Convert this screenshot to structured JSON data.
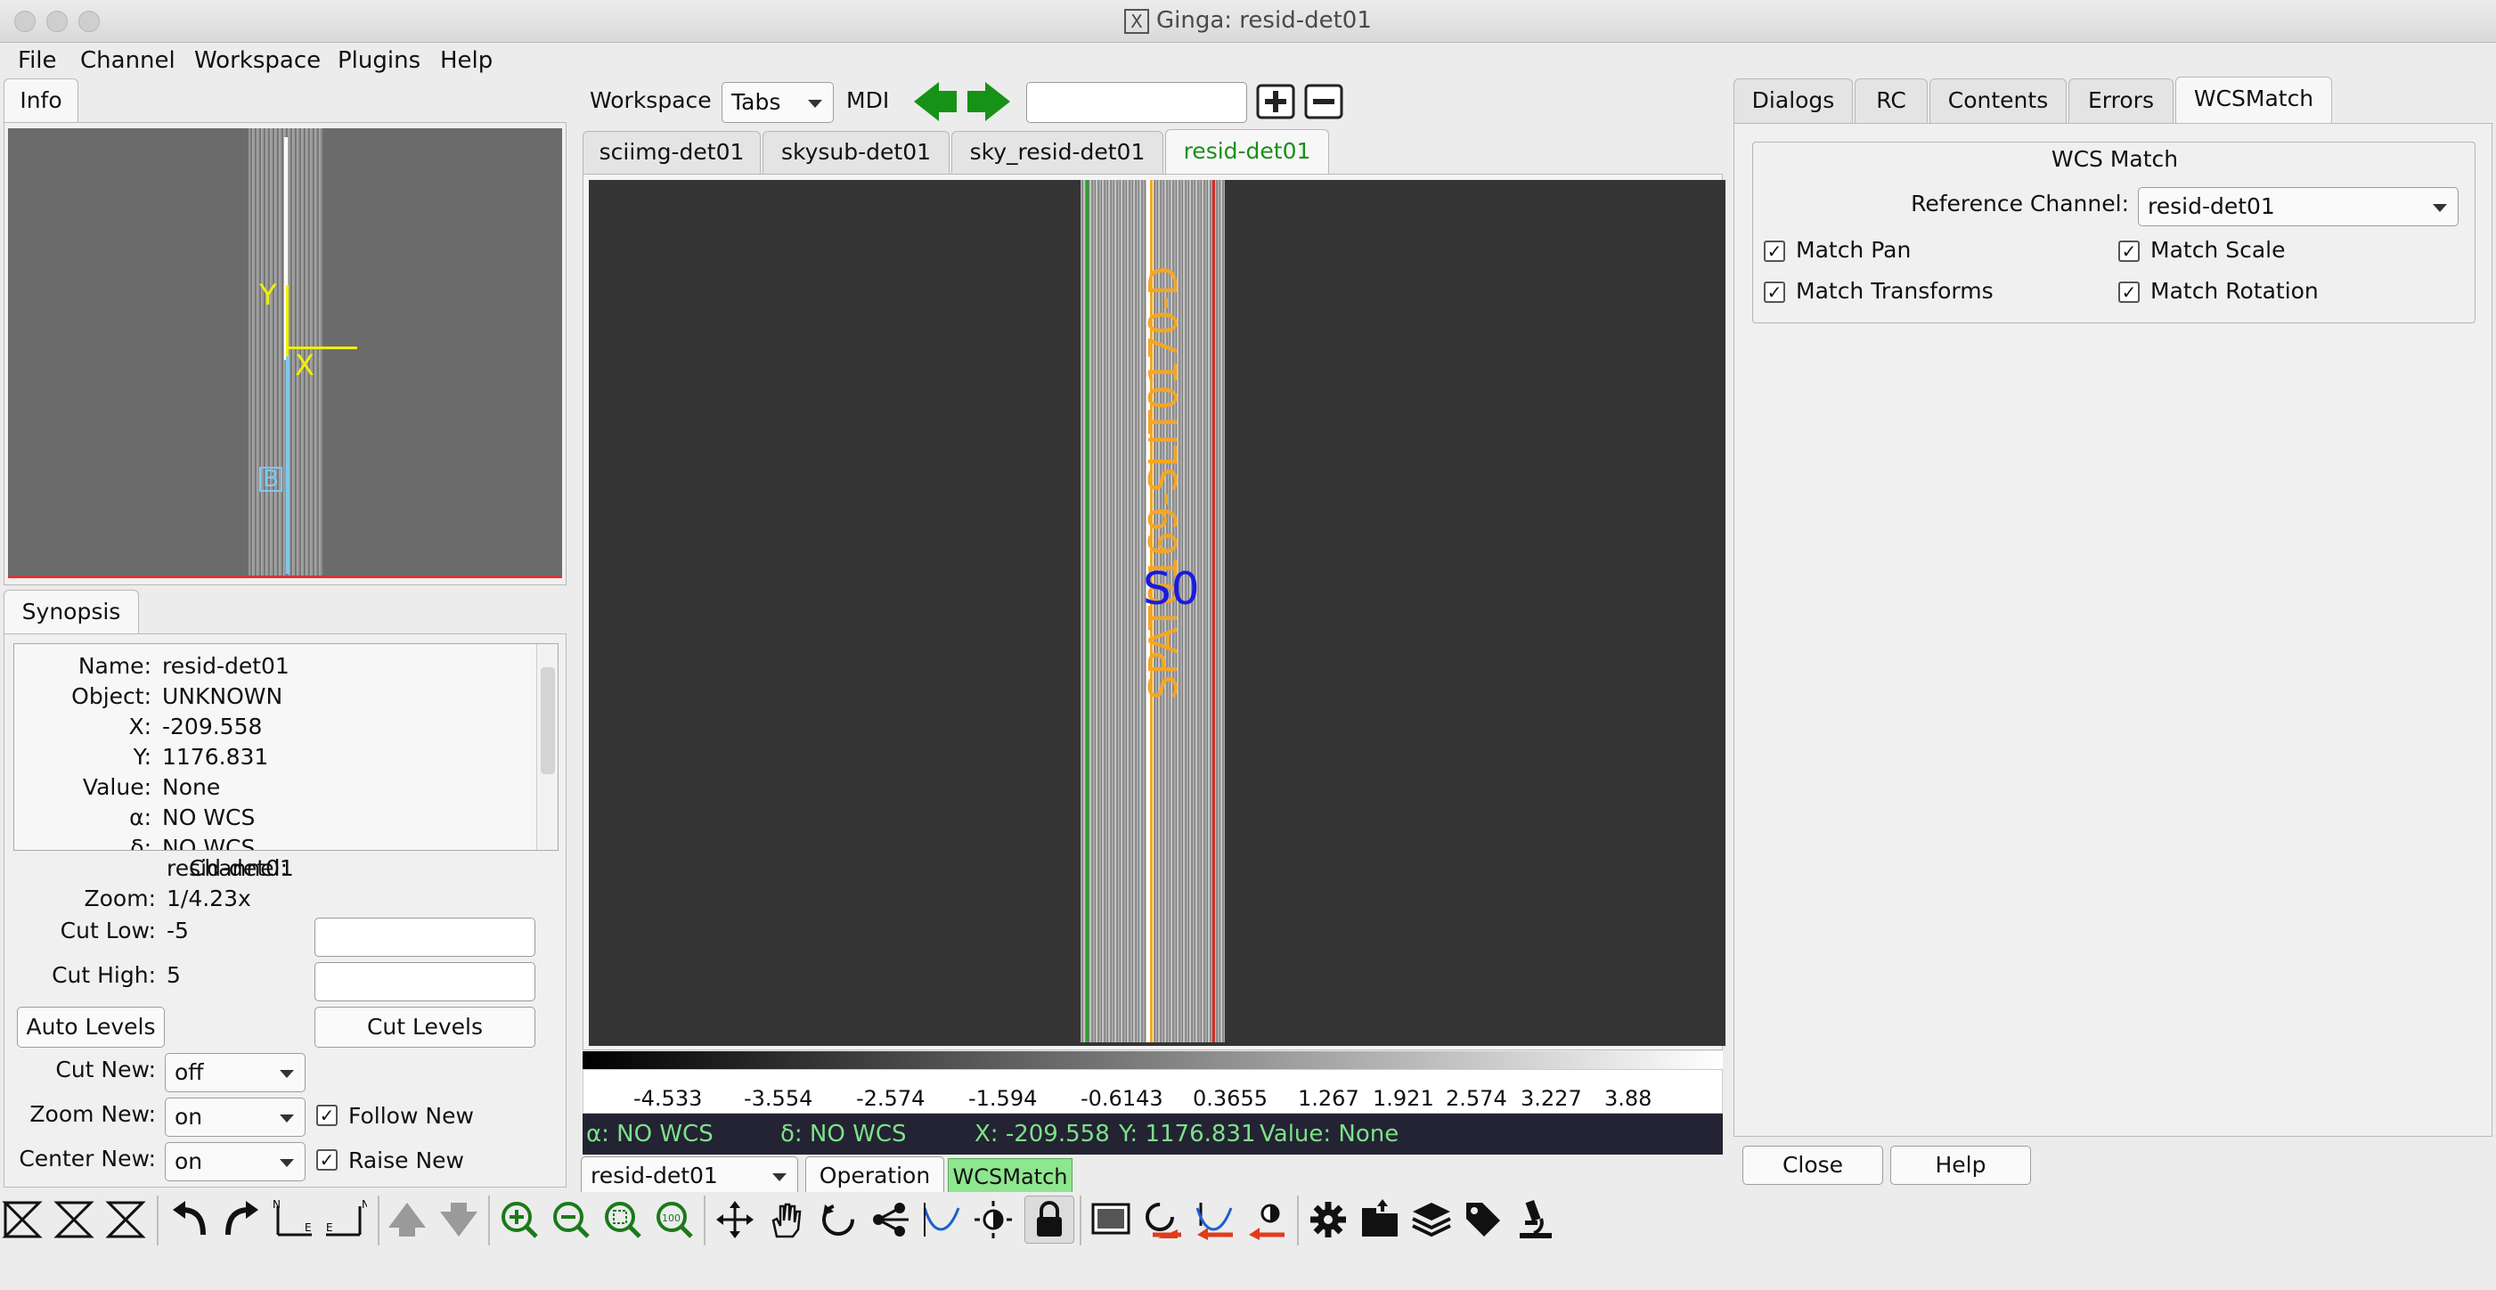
{
  "window": {
    "title": "Ginga: resid-det01"
  },
  "menubar": [
    "File",
    "Channel",
    "Workspace",
    "Plugins",
    "Help"
  ],
  "info": {
    "tab": "Info",
    "synopsis_tab": "Synopsis",
    "synopsis": [
      {
        "label": "Name:",
        "value": "resid-det01"
      },
      {
        "label": "Object:",
        "value": "UNKNOWN"
      },
      {
        "label": "X:",
        "value": "-209.558"
      },
      {
        "label": "Y:",
        "value": "1176.831"
      },
      {
        "label": "Value:",
        "value": "None"
      },
      {
        "label": "α:",
        "value": "NO WCS"
      },
      {
        "label": "δ:",
        "value": "NO WCS"
      }
    ],
    "channel_label": "Channel:",
    "channel": "resid-det01",
    "zoom_label": "Zoom:",
    "zoom": "1/4.23x",
    "cut_low_label": "Cut Low:",
    "cut_low": "-5",
    "cut_high_label": "Cut High:",
    "cut_high": "5",
    "auto_levels": "Auto Levels",
    "cut_levels": "Cut Levels",
    "cut_new_label": "Cut New:",
    "cut_new": "off",
    "zoom_new_label": "Zoom New:",
    "zoom_new": "on",
    "center_new_label": "Center New:",
    "center_new": "on",
    "follow_new": "Follow New",
    "raise_new": "Raise New",
    "pan_y": "Y",
    "pan_x": "X",
    "pan_b": "B"
  },
  "workspace": {
    "label": "Workspace",
    "mode": "Tabs",
    "mdi": "MDI",
    "tabs": [
      "sciimg-det01",
      "skysub-det01",
      "sky_resid-det01",
      "resid-det01"
    ],
    "active_tab": "resid-det01",
    "slit_label": "SPAT0169-SLIT0170-D",
    "object_label": "S0",
    "colorbar_ticks": [
      "-4.533",
      "-3.554",
      "-2.574",
      "-1.594",
      "-0.6143",
      "0.3655",
      "1.267",
      "1.921",
      "2.574",
      "3.227",
      "3.88"
    ],
    "status": {
      "alpha": "α: NO WCS",
      "delta": "δ: NO WCS",
      "x": "X: -209.558",
      "y": "Y: 1176.831",
      "value": "Value: None"
    },
    "channel_select": "resid-det01",
    "operation": "Operation",
    "wcsmatch": "WCSMatch"
  },
  "right": {
    "tabs": [
      "Dialogs",
      "RC",
      "Contents",
      "Errors",
      "WCSMatch"
    ],
    "active_tab": "WCSMatch",
    "group_title": "WCS Match",
    "ref_label": "Reference Channel:",
    "ref_value": "resid-det01",
    "match_pan": "Match Pan",
    "match_scale": "Match Scale",
    "match_transforms": "Match Transforms",
    "match_rotation": "Match Rotation",
    "close": "Close",
    "help": "Help"
  },
  "toolbar_icons": [
    "flip-x-icon",
    "flip-y-icon",
    "swap-xy-icon",
    "rotate-ccw-icon",
    "rotate-cw-icon",
    "orient-rh-icon",
    "orient-lh-icon",
    "prev-image-icon",
    "next-image-icon",
    "zoom-in-icon",
    "zoom-out-icon",
    "zoom-fit-icon",
    "zoom-100-icon",
    "pan-icon",
    "hand-icon",
    "rotate-mode-icon",
    "distribution-icon",
    "colormap-curve-icon",
    "contrast-icon",
    "lock-icon",
    "screen-icon",
    "reset-rotate-icon",
    "reset-cut-icon",
    "reset-contrast-icon",
    "settings-icon",
    "open-folder-icon",
    "layers-icon",
    "tags-icon",
    "microscope-icon"
  ],
  "colors": {
    "accent_green": "#1a8f1a",
    "slit_orange": "#e6a024",
    "object_blue": "#1a1ae0",
    "status_bg": "#232333",
    "status_text": "#7ee08a",
    "wcsmatch_bg": "#8ee68e"
  }
}
